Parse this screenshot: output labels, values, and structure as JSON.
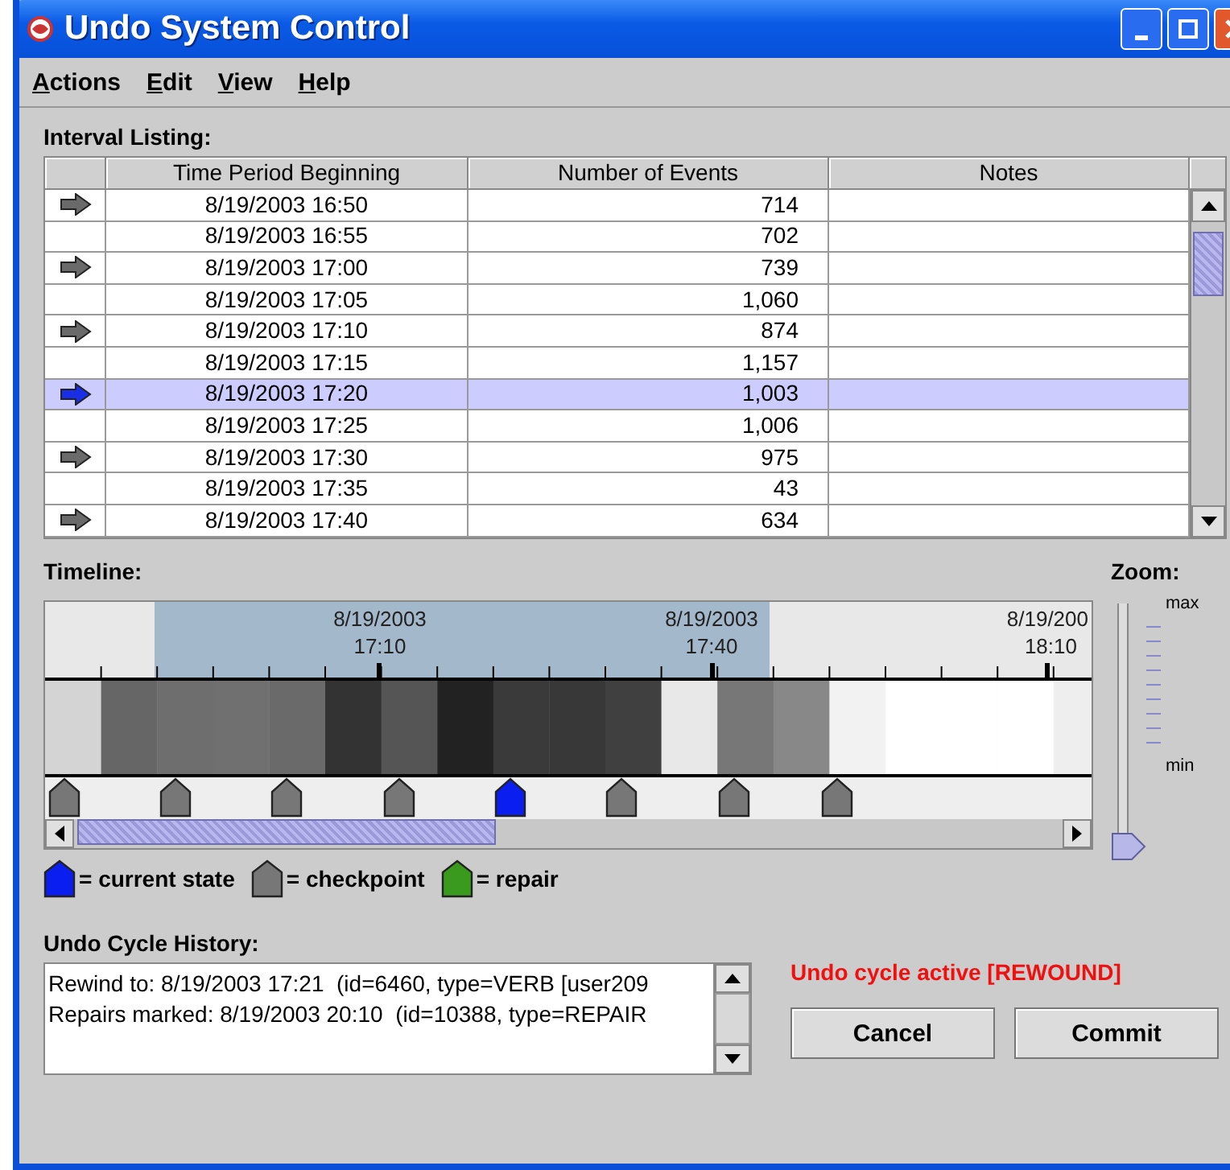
{
  "window": {
    "title": "Undo System Control"
  },
  "menu": [
    {
      "label": "Actions"
    },
    {
      "label": "Edit"
    },
    {
      "label": "View"
    },
    {
      "label": "Help"
    }
  ],
  "interval_listing": {
    "title": "Interval Listing:",
    "columns": [
      "Time Period Beginning",
      "Number of Events",
      "Notes"
    ],
    "rows": [
      {
        "kind": "checkpoint",
        "time": "8/19/2003 16:50",
        "events": "714",
        "selected": false
      },
      {
        "kind": "none",
        "time": "8/19/2003 16:55",
        "events": "702",
        "selected": false
      },
      {
        "kind": "checkpoint",
        "time": "8/19/2003 17:00",
        "events": "739",
        "selected": false
      },
      {
        "kind": "none",
        "time": "8/19/2003 17:05",
        "events": "1,060",
        "selected": false
      },
      {
        "kind": "checkpoint",
        "time": "8/19/2003 17:10",
        "events": "874",
        "selected": false
      },
      {
        "kind": "none",
        "time": "8/19/2003 17:15",
        "events": "1,157",
        "selected": false
      },
      {
        "kind": "current",
        "time": "8/19/2003 17:20",
        "events": "1,003",
        "selected": true
      },
      {
        "kind": "none",
        "time": "8/19/2003 17:25",
        "events": "1,006",
        "selected": false
      },
      {
        "kind": "checkpoint",
        "time": "8/19/2003 17:30",
        "events": "975",
        "selected": false
      },
      {
        "kind": "none",
        "time": "8/19/2003 17:35",
        "events": "43",
        "selected": false
      },
      {
        "kind": "checkpoint",
        "time": "8/19/2003 17:40",
        "events": "634",
        "selected": false
      }
    ]
  },
  "timeline": {
    "title": "Timeline:",
    "tick_labels": [
      {
        "date": "8/19/2003",
        "time": "17:10"
      },
      {
        "date": "8/19/2003",
        "time": "17:40"
      },
      {
        "date": "8/19/200",
        "time": "18:10"
      }
    ],
    "markers": [
      {
        "kind": "checkpoint"
      },
      {
        "kind": "checkpoint"
      },
      {
        "kind": "checkpoint"
      },
      {
        "kind": "checkpoint"
      },
      {
        "kind": "current"
      },
      {
        "kind": "checkpoint"
      },
      {
        "kind": "checkpoint"
      },
      {
        "kind": "checkpoint"
      }
    ]
  },
  "zoom": {
    "title": "Zoom:",
    "max_label": "max",
    "min_label": "min",
    "level": 0
  },
  "legend": [
    {
      "kind": "current",
      "label": "= current state"
    },
    {
      "kind": "checkpoint",
      "label": "= checkpoint"
    },
    {
      "kind": "repair",
      "label": "= repair"
    }
  ],
  "history": {
    "title": "Undo Cycle History:",
    "lines": [
      "Rewind to: 8/19/2003 17:21  (id=6460, type=VERB [user209",
      "Repairs marked: 8/19/2003 20:10  (id=10388, type=REPAIR"
    ]
  },
  "status": "Undo cycle active [REWOUND]",
  "buttons": [
    "Cancel",
    "Commit"
  ]
}
